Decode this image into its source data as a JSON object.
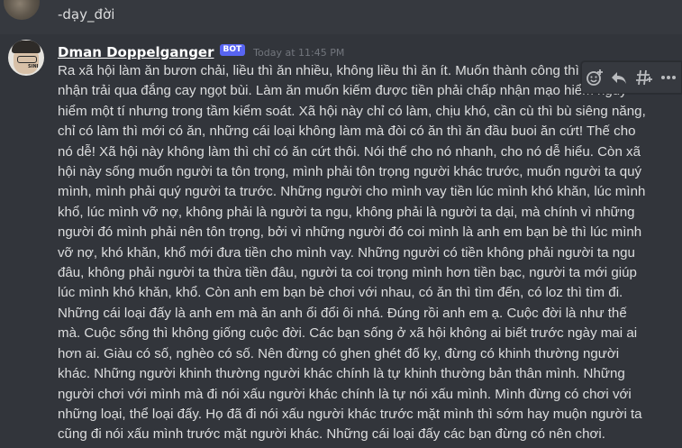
{
  "previous_message": {
    "text": "-dạy_đời"
  },
  "message": {
    "username": "Dman Doppelganger",
    "badge": "BOT",
    "timestamp": "Today at 11:45 PM",
    "avatar_tag": "SINI",
    "content": "Ra xã hội làm ăn bươn chải, liều thì ăn nhiều, không liều thì ăn ít. Muốn thành công thì phải chấp nhận trải qua đắng cay ngọt bùi. Làm ăn muốn kiếm được tiền phải chấp nhận mạo hiểm nguy hiểm một tí nhưng trong tầm kiểm soát. Xã hội này chỉ có làm, chịu khó, cần cù thì bù siêng năng, chỉ có làm thì mới có ăn, những cái loại không làm mà đòi có ăn thì ăn đầu buoi ăn cứt! Thế cho nó dễ! Xã hội này không làm thì chỉ có ăn cứt thôi. Nói thế cho nó nhanh, cho nó dễ hiểu. Còn xã hội này sống muốn người ta tôn trọng, mình phải tôn trọng người khác trước, muốn người ta quý mình, mình phải quý người ta trước. Những người cho mình vay tiền lúc mình khó khăn, lúc mình khổ, lúc mình vỡ nợ, không phải là người ta ngu, không phải là người ta dại, mà chính vì những người đó mình phải nên tôn trọng, bởi vì những người đó coi mình là anh em bạn bè thì lúc mình vỡ nợ, khó khăn, khổ mới đưa tiền cho mình vay. Những người có tiền không phải người ta ngu đâu, không phải người ta thừa tiền đâu, người ta coi trọng mình hơn tiền bạc, người ta mới giúp lúc mình khó khăn, khổ. Còn anh em bạn bè chơi với nhau, có ăn thì tìm đến, có loz thì tìm đi. Những cái loại đấy là anh em mà ăn anh ổi đổi ôi nhá. Đúng rồi anh em ạ. Cuộc đời là như thế mà. Cuộc sống thì không giống cuộc đời. Các bạn sống ở xã hội không ai biết trước ngày mai ai hơn ai. Giàu có số, nghèo có số. Nên đừng có ghen ghét đố kỵ, đừng có khinh thường người khác. Những người khinh thường người khác chính là tự khinh thường bản thân mình. Những người chơi với mình mà đi nói xấu người khác chính là tự nói xấu mình. Mình đừng có chơi với những loại, thể loại đấy. Họ đã đi nói xấu người khác trước mặt mình thì sớm hay muộn người ta cũng đi nói xấu mình trước mặt người khác. Những cái loại đấy các bạn đừng có nên chơi."
  },
  "toolbar": {
    "icons": [
      "add-reaction-icon",
      "reply-icon",
      "create-thread-icon",
      "more-options-icon"
    ]
  },
  "colors": {
    "background": "#36393f",
    "hover_background": "#32353b",
    "bot_badge": "#5865f2",
    "text": "#dcddde",
    "timestamp": "#72767d"
  }
}
